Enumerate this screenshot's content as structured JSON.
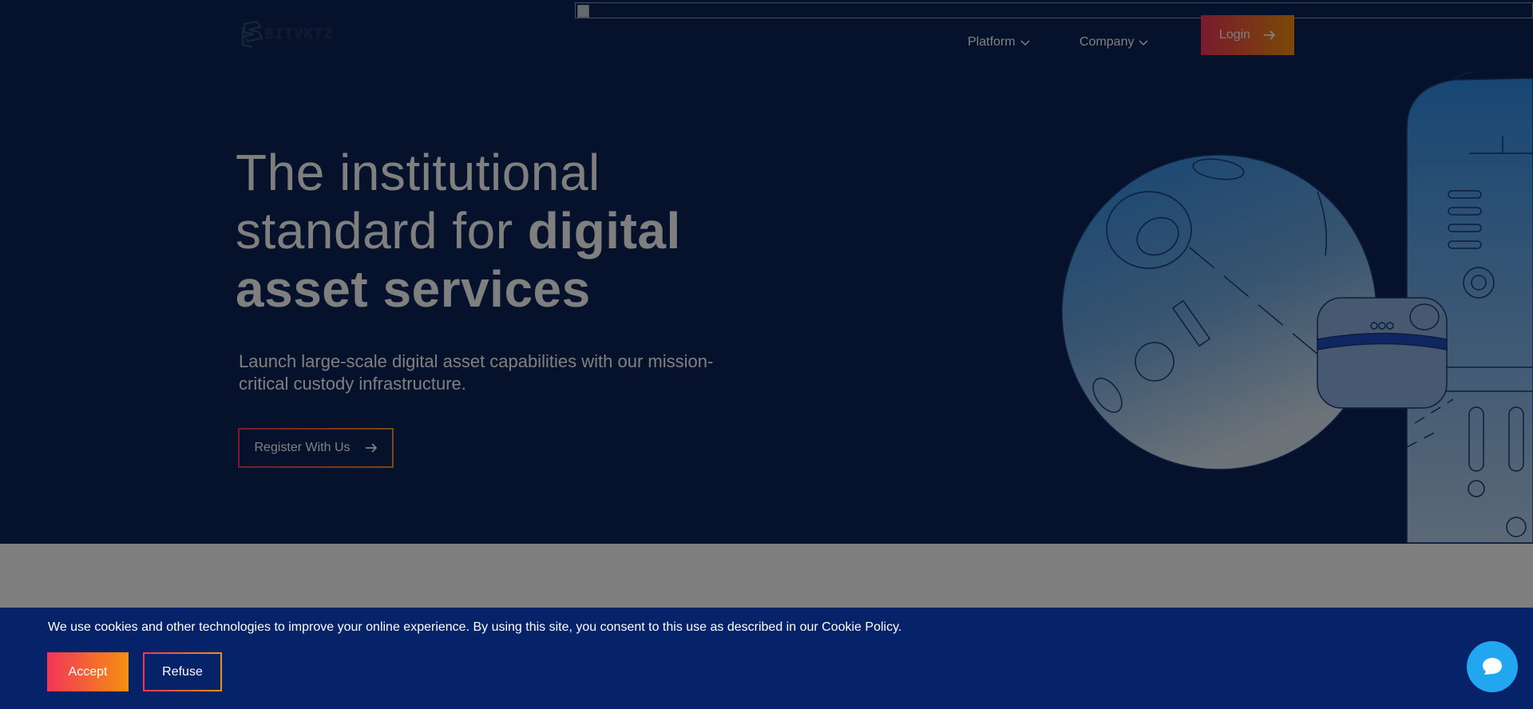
{
  "brand": {
    "logo_text": "BITVKTZ",
    "colors": {
      "hero_bg": "#0d2456",
      "accent_start": "#f2365a",
      "accent_end": "#f5900f",
      "cookie_bg": "#062269",
      "chat_bg": "#22a6f0"
    }
  },
  "nav": {
    "items": [
      {
        "label": "Platform",
        "icon": "chevron-down-icon"
      },
      {
        "label": "Company",
        "icon": "chevron-down-icon"
      }
    ],
    "login_label": "Login"
  },
  "hero": {
    "headline_light": "The institutional standard for ",
    "headline_bold": "digital asset services",
    "subheadline": "Launch large-scale digital asset capabilities with our mission-critical custody infrastructure.",
    "cta_label": "Register With Us"
  },
  "cookie_banner": {
    "text": "We use cookies and other technologies to improve your online experience. By using this site, you consent to this use as described in our Cookie Policy.",
    "accept_label": "Accept",
    "refuse_label": "Refuse"
  },
  "chat": {
    "icon": "chat-bubble-icon"
  }
}
